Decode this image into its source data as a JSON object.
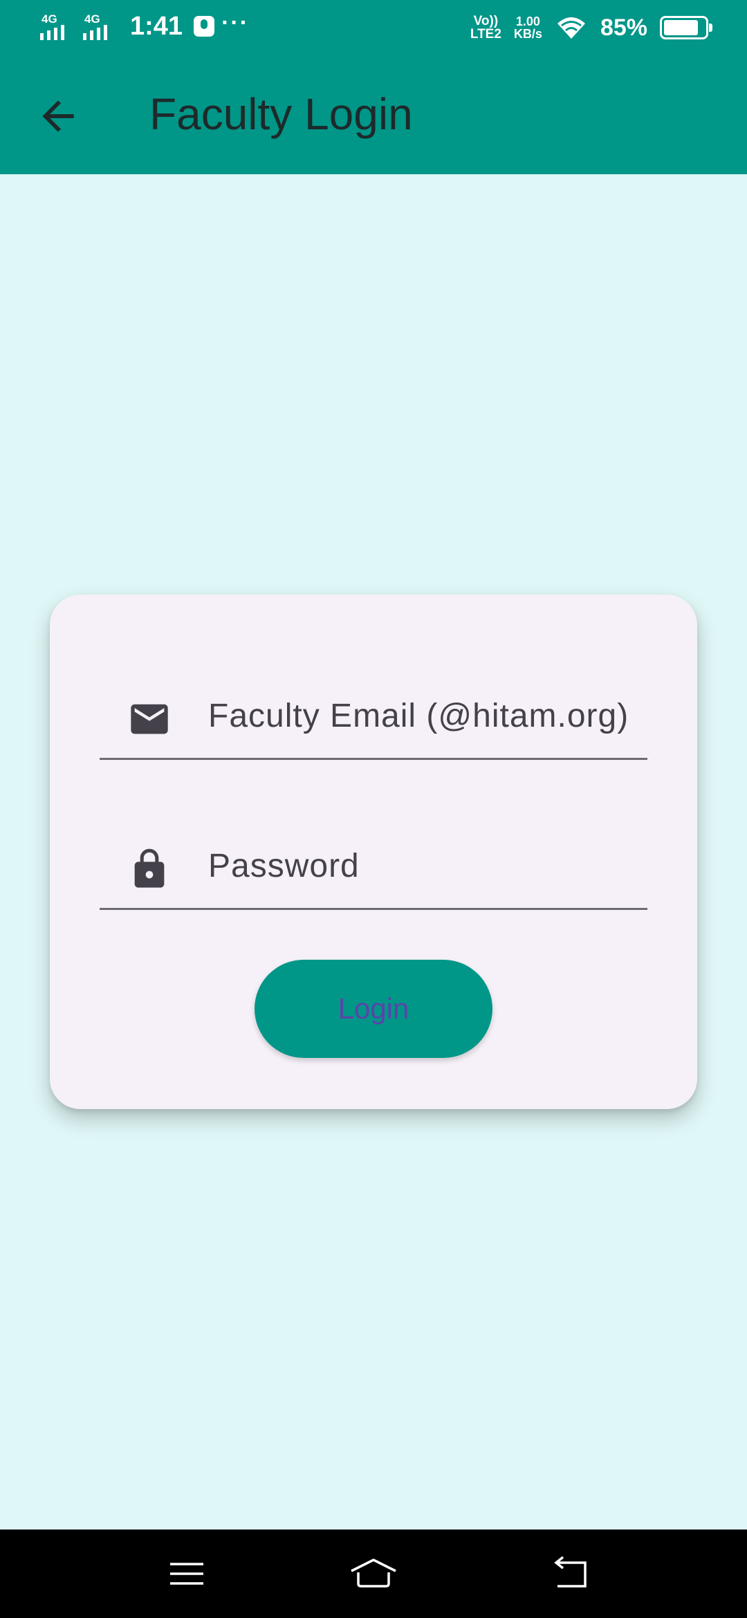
{
  "status_bar": {
    "network_1": "4G",
    "network_2": "4G",
    "time": "1:41",
    "more": "···",
    "volte_line1": "Vo))",
    "volte_line2": "LTE2",
    "speed_value": "1.00",
    "speed_unit": "KB/s",
    "battery_percent": "85%",
    "battery_level": 0.85
  },
  "app_bar": {
    "title": "Faculty Login",
    "back_icon": "arrow-back-icon"
  },
  "form": {
    "email_placeholder": "Faculty Email (@hitam.org)",
    "email_value": "",
    "email_icon": "mail-icon",
    "password_placeholder": "Password",
    "password_value": "",
    "password_icon": "lock-icon",
    "login_label": "Login"
  },
  "colors": {
    "accent": "#009688",
    "background": "#e0f7f7",
    "card": "#f6f1f8",
    "button_text": "#5a44a8"
  },
  "nav_bar": {
    "menu_icon": "menu-icon",
    "home_icon": "home-icon",
    "back_icon": "back-icon"
  }
}
